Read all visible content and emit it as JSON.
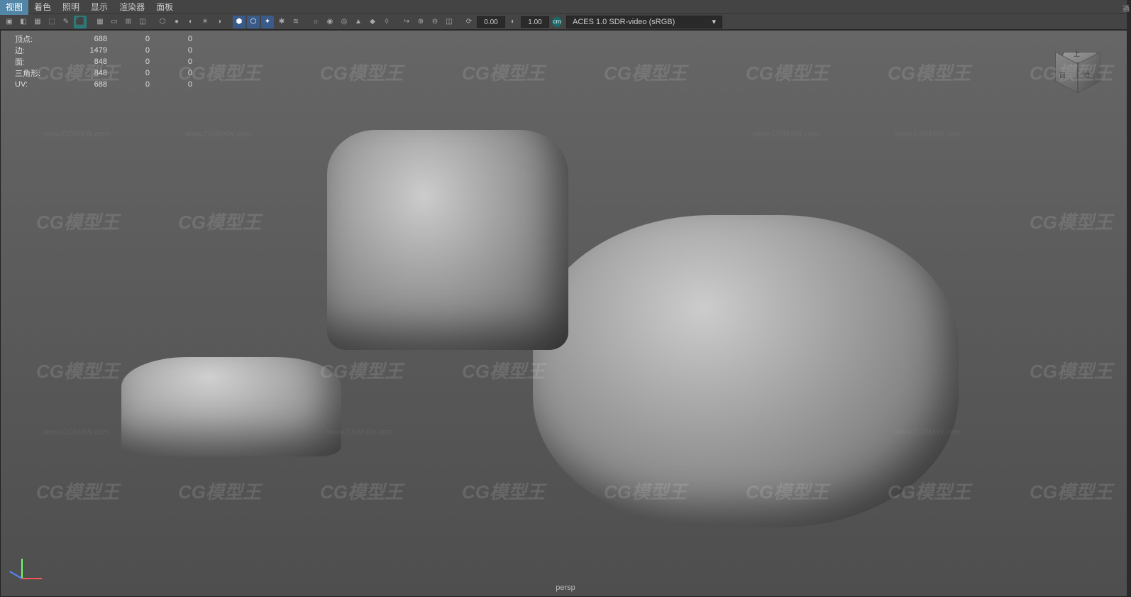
{
  "menu": {
    "view": "视图",
    "shading": "着色",
    "lighting": "照明",
    "show": "显示",
    "renderer": "渲染器",
    "panels": "面板"
  },
  "toolbar": {
    "num1": "0.00",
    "num2": "1.00",
    "color_space": "ACES 1.0 SDR-video (sRGB)"
  },
  "stats": {
    "verts_label": "顶点:",
    "verts": [
      "688",
      "0",
      "0"
    ],
    "edges_label": "边:",
    "edges": [
      "1479",
      "0",
      "0"
    ],
    "faces_label": "面:",
    "faces": [
      "848",
      "0",
      "0"
    ],
    "tris_label": "三角形:",
    "tris": [
      "848",
      "0",
      "0"
    ],
    "uv_label": "UV:",
    "uv": [
      "688",
      "0",
      "0"
    ]
  },
  "viewport": {
    "camera": "persp"
  },
  "viewcube": {
    "front": "前",
    "right": "右",
    "top": "上"
  },
  "watermark": {
    "text": "CG模型王",
    "url": "www.CGMXW.com"
  },
  "right_panel_hint": "通"
}
